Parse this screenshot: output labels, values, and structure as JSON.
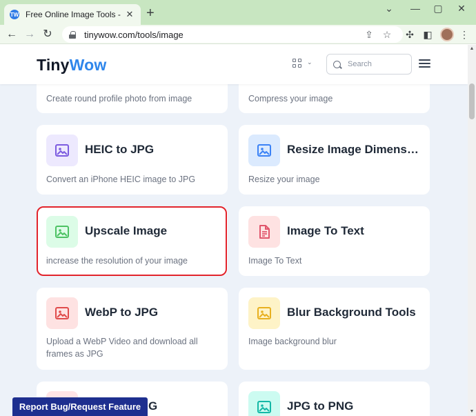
{
  "browser": {
    "tab_title": "Free Online Image Tools - TinyWow",
    "tab_close": "✕",
    "new_tab": "+",
    "url": "tinywow.com/tools/image",
    "window_controls": [
      "⌄",
      "—",
      "▢",
      "✕"
    ]
  },
  "header": {
    "logo_part1": "Tiny",
    "logo_part2": "Wow",
    "search_placeholder": "Search",
    "logo_accent_color": "#2f86eb"
  },
  "cards": [
    {
      "title": "",
      "desc": "Create round profile photo from image",
      "icon_color": "#ede9fe"
    },
    {
      "title": "",
      "desc": "Compress your image",
      "icon_color": "#dbeafe"
    },
    {
      "title": "HEIC to JPG",
      "desc": "Convert an iPhone HEIC image to JPG",
      "icon": "image-icon",
      "icon_color": "#ede9fe",
      "icon_fg": "#7c5ce0"
    },
    {
      "title": "Resize Image Dimens…",
      "desc": "Resize your image",
      "icon": "image-icon",
      "icon_color": "#dbeafe",
      "icon_fg": "#3b82f6"
    },
    {
      "title": "Upscale Image",
      "desc": "increase the resolution of your image",
      "icon": "image-icon",
      "icon_color": "#dcfce7",
      "icon_fg": "#4cc263"
    },
    {
      "title": "Image To Text",
      "desc": "Image To Text",
      "icon": "document-icon",
      "icon_color": "#fee2e2",
      "icon_fg": "#e0556b"
    },
    {
      "title": "WebP to JPG",
      "desc": "Upload a WebP Video and download all frames as JPG",
      "icon": "image-icon",
      "icon_color": "#fee2e2",
      "icon_fg": "#e04b4b"
    },
    {
      "title": "Blur Background Tools",
      "desc": "Image background blur",
      "icon": "image-icon",
      "icon_color": "#fef3c7",
      "icon_fg": "#e8b020"
    },
    {
      "title": "G",
      "desc": "",
      "icon": "image-icon",
      "icon_color": "#ffe4e6",
      "icon_fg": "#e05a6f"
    },
    {
      "title": "JPG to PNG",
      "desc": "",
      "icon": "image-icon",
      "icon_color": "#ccfbf1",
      "icon_fg": "#14b8a6"
    }
  ],
  "report_button": "Report Bug/Request Feature",
  "highlight_color": "#e2232b"
}
